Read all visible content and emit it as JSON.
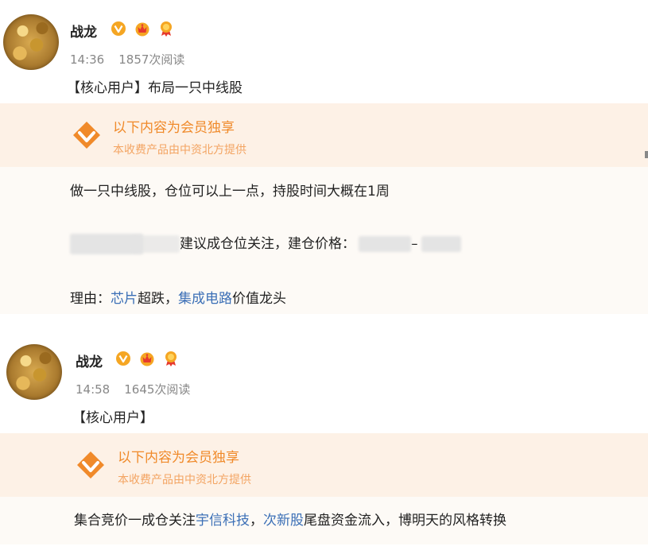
{
  "posts": [
    {
      "author": "战龙",
      "time": "14:36",
      "reads": "1857次阅读",
      "headline": "【核心用户】布局一只中线股",
      "vip_title": "以下内容为会员独享",
      "vip_sub": "本收费产品由中资北方提供",
      "content": {
        "line1": "做一只中线股，仓位可以上一点，持股时间大概在1周",
        "line2_text": "建议成仓位关注，建仓价格：",
        "line2_sep": "–",
        "line3_prefix": "理由：",
        "line3_link1": "芯片",
        "line3_mid": "超跌，",
        "line3_link2": "集成电路",
        "line3_suffix": "价值龙头"
      }
    },
    {
      "author": "战龙",
      "time": "14:58",
      "reads": "1645次阅读",
      "headline": "【核心用户】",
      "vip_title": "以下内容为会员独享",
      "vip_sub": "本收费产品由中资北方提供",
      "content": {
        "prefix": "集合竞价一成仓关注",
        "link1": "宇信科技",
        "mid": "，",
        "link2": "次新股",
        "suffix": "尾盘资金流入，博明天的风格转换"
      }
    }
  ],
  "icons": {
    "verified": "verified-v-icon",
    "crown": "crown-icon",
    "medal": "medal-icon",
    "vip": "vip-diamond-icon"
  },
  "colors": {
    "accent_orange": "#f08a2a",
    "link_blue": "#3b6fb6",
    "banner_bg": "#fdf1e6"
  }
}
